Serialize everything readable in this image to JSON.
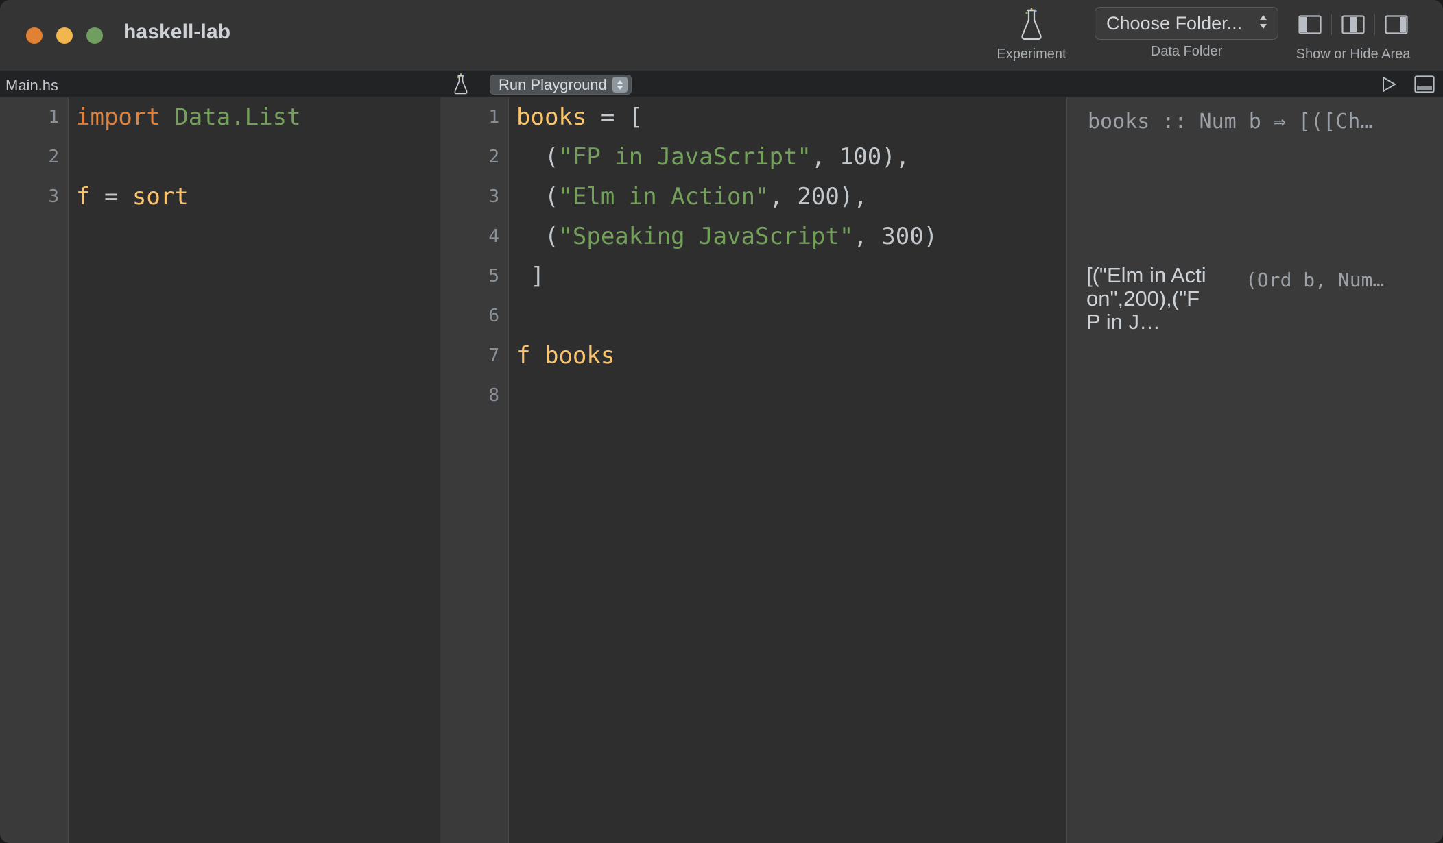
{
  "window": {
    "title": "haskell-lab",
    "traffic_lights": [
      {
        "name": "close",
        "color": "#e08134"
      },
      {
        "name": "minimize",
        "color": "#f2b64e"
      },
      {
        "name": "zoom",
        "color": "#6f9e60"
      }
    ]
  },
  "toolbar": {
    "experiment": {
      "label": "Experiment",
      "icon": "flask-icon"
    },
    "data_folder": {
      "label": "Data Folder",
      "select_value": "Choose Folder...",
      "stepper_icon": "up-down-chevron-icon"
    },
    "show_or_hide": {
      "label": "Show or Hide Area",
      "buttons": [
        {
          "name": "toggle-left-panel",
          "icon": "panel-left-icon"
        },
        {
          "name": "toggle-center-panel",
          "icon": "panel-center-icon"
        },
        {
          "name": "toggle-right-panel",
          "icon": "panel-right-icon"
        }
      ]
    }
  },
  "tabbar": {
    "filename": "Main.hs",
    "flask_icon": "flask-icon",
    "run_mode": "Run Playground",
    "run_stepper_icon": "up-down-chevron-icon",
    "play_icon": "play-triangle-icon",
    "panel_icon": "panel-bottom-icon"
  },
  "editor_left": {
    "line_numbers": [
      "1",
      "2",
      "3"
    ],
    "lines": [
      [
        {
          "t": "import",
          "c": "tok-kw"
        },
        {
          "t": " ",
          "c": "tok-pun"
        },
        {
          "t": "Data.List",
          "c": "tok-mod"
        }
      ],
      [],
      [
        {
          "t": "f",
          "c": "tok-fn"
        },
        {
          "t": " = ",
          "c": "tok-pun"
        },
        {
          "t": "sort",
          "c": "tok-fn"
        }
      ]
    ]
  },
  "editor_mid": {
    "line_numbers": [
      "1",
      "2",
      "3",
      "4",
      "5",
      "6",
      "7",
      "8"
    ],
    "lines": [
      [
        {
          "t": "books",
          "c": "tok-fn"
        },
        {
          "t": " = [",
          "c": "tok-pun"
        }
      ],
      [
        {
          "t": "  (",
          "c": "tok-pun"
        },
        {
          "t": "\"FP in JavaScript\"",
          "c": "tok-str"
        },
        {
          "t": ", ",
          "c": "tok-pun"
        },
        {
          "t": "100",
          "c": "tok-num"
        },
        {
          "t": "),",
          "c": "tok-pun"
        }
      ],
      [
        {
          "t": "  (",
          "c": "tok-pun"
        },
        {
          "t": "\"Elm in Action\"",
          "c": "tok-str"
        },
        {
          "t": ", ",
          "c": "tok-pun"
        },
        {
          "t": "200",
          "c": "tok-num"
        },
        {
          "t": "),",
          "c": "tok-pun"
        }
      ],
      [
        {
          "t": "  (",
          "c": "tok-pun"
        },
        {
          "t": "\"Speaking JavaScript\"",
          "c": "tok-str"
        },
        {
          "t": ", ",
          "c": "tok-pun"
        },
        {
          "t": "300",
          "c": "tok-num"
        },
        {
          "t": ")",
          "c": "tok-pun"
        }
      ],
      [
        {
          "t": " ]",
          "c": "tok-pun"
        }
      ],
      [],
      [
        {
          "t": "f",
          "c": "tok-fn"
        },
        {
          "t": " ",
          "c": "tok-pun"
        },
        {
          "t": "books",
          "c": "tok-fn"
        }
      ],
      []
    ]
  },
  "results": {
    "type_signature": "books :: Num b ⇒ [([Ch…",
    "value": "[(\"Elm in Action\",200),(\"FP in J…",
    "constraint": "(Ord b, Num…"
  }
}
